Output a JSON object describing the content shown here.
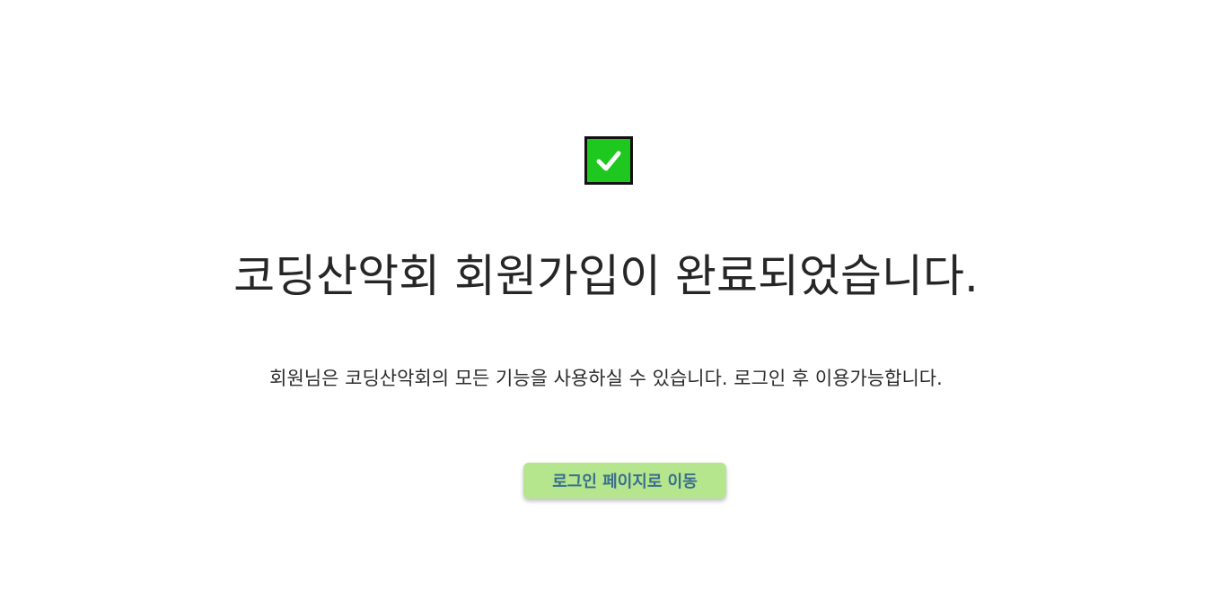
{
  "success_icon": {
    "icon": "check-mark-icon",
    "background_color": "#1ec81e",
    "border_color": "#111111"
  },
  "heading": "코딩산악회 회원가입이 완료되었습니다.",
  "message": "회원님은 코딩산악회의 모든 기능을 사용하실 수 있습니다. 로그인 후 이용가능합니다.",
  "login_button": {
    "label": "로그인 페이지로 이동",
    "background_color": "#b5e58c",
    "text_color": "#3a6e8f"
  }
}
